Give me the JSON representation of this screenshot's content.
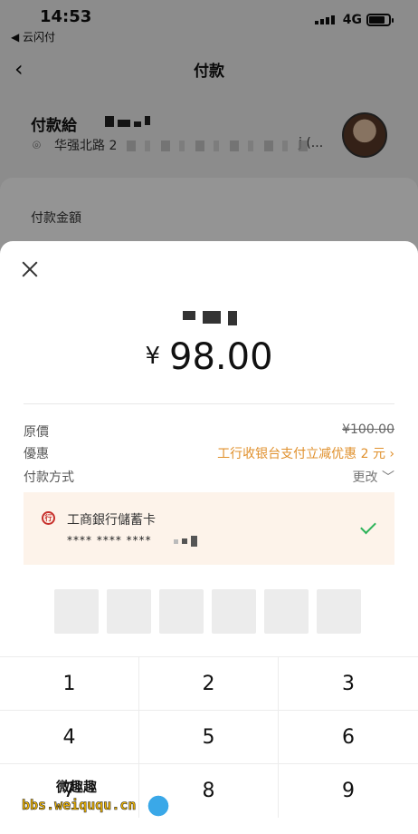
{
  "status_bar": {
    "time": "14:53",
    "back_app": "◀ 云闪付",
    "network": "4G"
  },
  "nav": {
    "back_icon": "‹",
    "title": "付款"
  },
  "payee": {
    "label": "付款給",
    "address": "华强北路 2",
    "address_suffix": "j (..."
  },
  "background": {
    "amount_label": "付款金額"
  },
  "sheet": {
    "amount_currency": "¥",
    "amount_value": "98.00",
    "details": {
      "original_price_label": "原價",
      "original_price_value": "¥100.00",
      "discount_label": "優惠",
      "discount_value": "工行收银台支付立减优惠 2 元 ›",
      "payment_method_label": "付款方式",
      "payment_method_action": "更改 ﹀"
    },
    "card": {
      "bank_icon": "行",
      "bank_name": "工商銀行儲蓄卡",
      "card_number": "**** **** ****"
    },
    "keypad": [
      "1",
      "2",
      "3",
      "4",
      "5",
      "6",
      "7",
      "8",
      "9"
    ]
  },
  "watermark": {
    "title": "微趣趣",
    "url": "bbs.weiququ.cn"
  },
  "colors": {
    "discount": "#e0902c",
    "check": "#2eb35a",
    "card_bg": "#fdf3ea"
  }
}
